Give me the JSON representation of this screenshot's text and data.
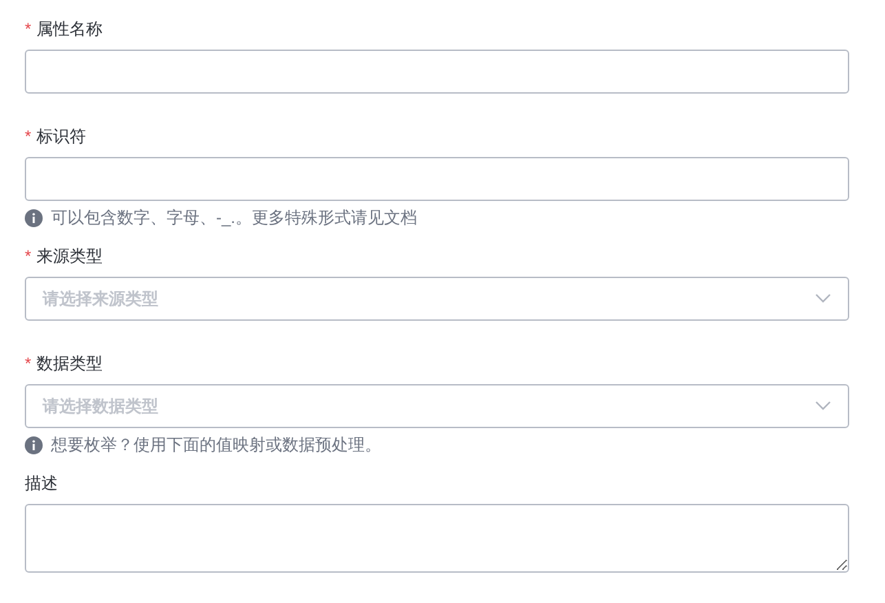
{
  "fields": [
    {
      "kind": "text",
      "required_mark": "*",
      "label": "属性名称"
    },
    {
      "kind": "text",
      "required_mark": "*",
      "label": "标识符",
      "help": "可以包含数字、字母、-_.。更多特殊形式请见文档"
    },
    {
      "kind": "select",
      "required_mark": "*",
      "label": "来源类型",
      "placeholder": "请选择来源类型"
    },
    {
      "kind": "select",
      "required_mark": "*",
      "label": "数据类型",
      "placeholder": "请选择数据类型",
      "help": "想要枚举？使用下面的值映射或数据预处理。"
    },
    {
      "kind": "textarea",
      "label": "描述"
    }
  ]
}
